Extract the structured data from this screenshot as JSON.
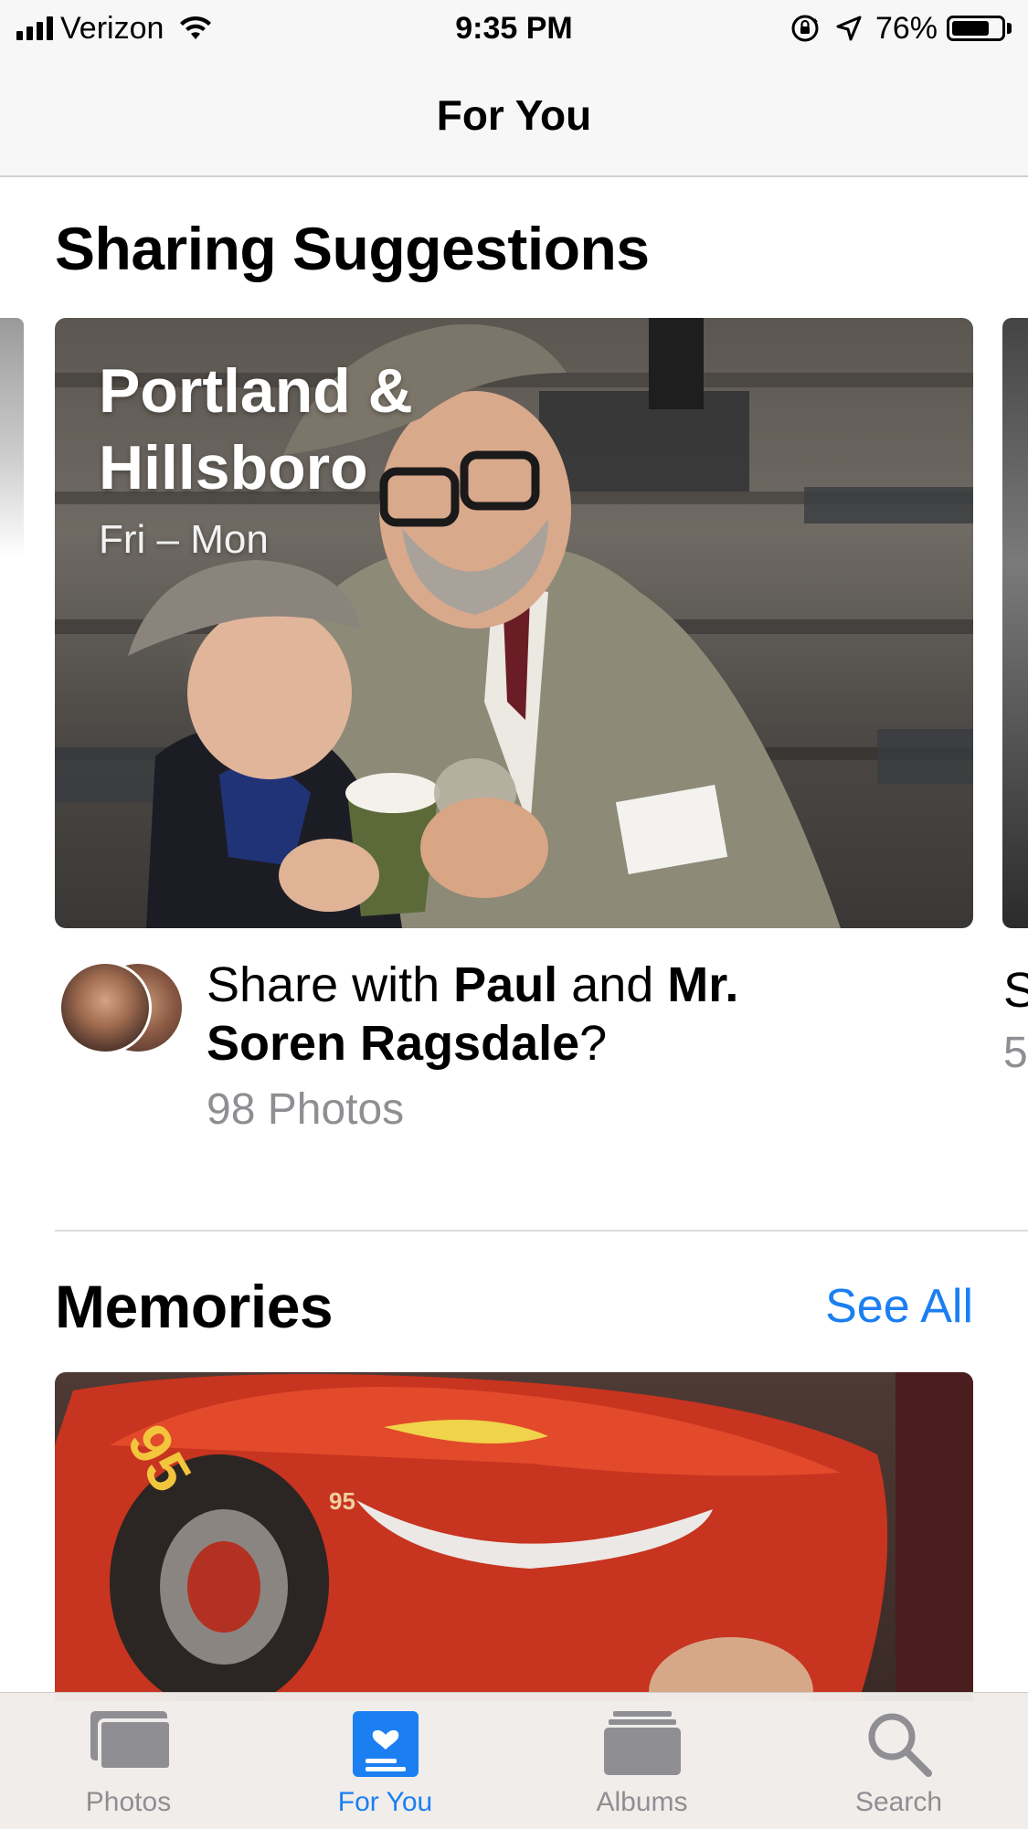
{
  "status_bar": {
    "carrier": "Verizon",
    "time": "9:35 PM",
    "battery_percent": "76%",
    "battery_level": 0.76,
    "icons": [
      "signal-bars-icon",
      "wifi-icon",
      "orientation-lock-icon",
      "location-arrow-icon",
      "battery-icon"
    ]
  },
  "nav": {
    "title": "For You"
  },
  "sharing": {
    "section_title": "Sharing Suggestions",
    "card": {
      "title": "Portland & Hillsboro",
      "dates": "Fri – Mon"
    },
    "share_prefix": "Share with ",
    "person1": "Paul",
    "share_and": " and ",
    "person2": "Mr. Soren Ragsdale",
    "share_suffix": "?",
    "photo_count": "98 Photos",
    "peek_share_text": "S",
    "peek_count": "5"
  },
  "memories": {
    "section_title": "Memories",
    "see_all": "See All"
  },
  "tab_bar": {
    "active": "For You",
    "tabs": [
      {
        "label": "Photos",
        "icon": "photos-icon"
      },
      {
        "label": "For You",
        "icon": "for-you-icon"
      },
      {
        "label": "Albums",
        "icon": "albums-icon"
      },
      {
        "label": "Search",
        "icon": "search-icon"
      }
    ]
  },
  "colors": {
    "accent": "#1b7ff2",
    "secondary_text": "#8e8e93",
    "bar_background": "#f7f7f7"
  }
}
